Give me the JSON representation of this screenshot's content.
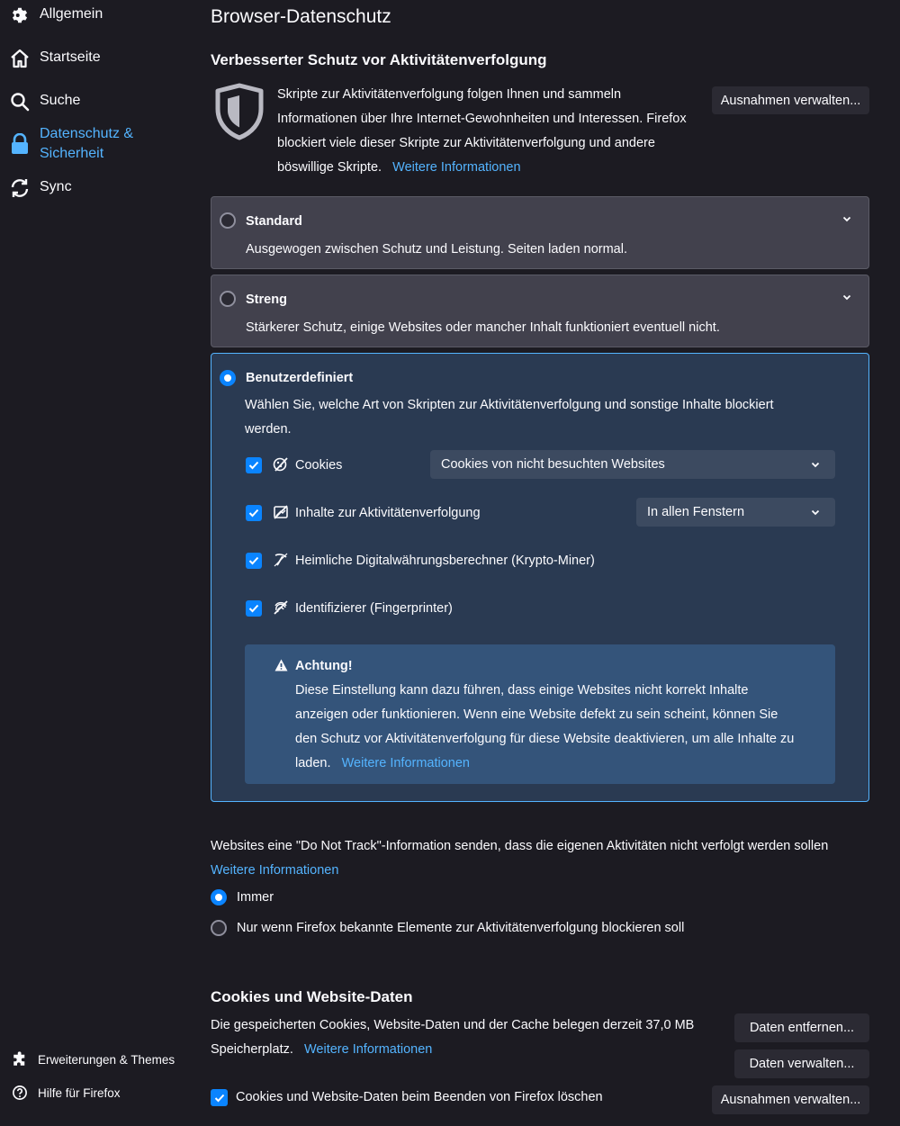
{
  "sidebar": {
    "items": [
      {
        "label": "Allgemein",
        "icon": "gear-icon"
      },
      {
        "label": "Startseite",
        "icon": "home-icon"
      },
      {
        "label": "Suche",
        "icon": "search-icon"
      },
      {
        "label": "Datenschutz &",
        "label2": "Sicherheit",
        "icon": "lock-icon",
        "active": true
      },
      {
        "label": "Sync",
        "icon": "sync-icon"
      }
    ],
    "footer": [
      {
        "label": "Erweiterungen & Themes",
        "icon": "puzzle-icon"
      },
      {
        "label": "Hilfe für Firefox",
        "icon": "help-icon"
      }
    ]
  },
  "page": {
    "title": "Browser-Datenschutz"
  },
  "etp": {
    "heading": "Verbesserter Schutz vor Aktivitätenverfolgung",
    "desc_lines": [
      "Skripte zur Aktivitätenverfolgung folgen Ihnen und sammeln",
      "Informationen über Ihre Internet-Gewohnheiten und Interessen. Firefox",
      "blockiert viele dieser Skripte zur Aktivitätenverfolgung und andere",
      "böswillige Skripte."
    ],
    "learn_more": "Weitere Informationen",
    "exceptions_button": "Ausnahmen verwalten...",
    "standard": {
      "label": "Standard",
      "desc": "Ausgewogen zwischen Schutz und Leistung. Seiten laden normal."
    },
    "strict": {
      "label": "Streng",
      "desc": "Stärkerer Schutz, einige Websites oder mancher Inhalt funktioniert eventuell nicht."
    },
    "custom": {
      "label": "Benutzerdefiniert",
      "desc_lines": [
        "Wählen Sie, welche Art von Skripten zur Aktivitätenverfolgung und sonstige Inhalte blockiert",
        "werden."
      ],
      "options": [
        {
          "label": "Cookies",
          "icon": "cookie-icon",
          "checked": true
        },
        {
          "label": "Inhalte zur Aktivitätenverfolgung",
          "icon": "tracking-content-icon",
          "checked": true
        },
        {
          "label": "Heimliche Digitalwährungsberechner (Krypto-Miner)",
          "icon": "cryptominer-icon",
          "checked": true
        },
        {
          "label": "Identifizierer (Fingerprinter)",
          "icon": "fingerprint-icon",
          "checked": true
        }
      ],
      "cookies_select": "Cookies von nicht besuchten Websites",
      "tracking_select": "In allen Fenstern",
      "warning": {
        "title": "Achtung!",
        "lines": [
          "Diese Einstellung kann dazu führen, dass einige Websites nicht korrekt Inhalte",
          "anzeigen oder funktionieren. Wenn eine Website defekt zu sein scheint, können Sie",
          "den Schutz vor Aktivitätenverfolgung für diese Website deaktivieren, um alle Inhalte zu",
          "laden."
        ],
        "learn_more": "Weitere Informationen"
      }
    }
  },
  "dnt": {
    "text": "Websites eine \"Do Not Track\"-Information senden, dass die eigenen Aktivitäten nicht verfolgt werden sollen",
    "learn_more": "Weitere Informationen",
    "always": "Immer",
    "only_when": "Nur wenn Firefox bekannte Elemente zur Aktivitätenverfolgung blockieren soll",
    "selected": "always"
  },
  "cookies_data": {
    "heading": "Cookies und Website-Daten",
    "line1": "Die gespeicherten Cookies, Website-Daten und der Cache belegen derzeit 37,0 MB",
    "line2": "Speicherplatz.",
    "learn_more": "Weitere Informationen",
    "clear_button": "Daten entfernen...",
    "manage_button": "Daten verwalten...",
    "exceptions_button": "Ausnahmen verwalten...",
    "delete_on_close": "Cookies und Website-Daten beim Beenden von Firefox löschen",
    "delete_on_close_checked": true
  },
  "colors": {
    "background": "#1c1b22",
    "accent": "#0a84ff",
    "link": "#54b4ff",
    "card": "#42414d",
    "selected_card": "#2a3a52"
  }
}
